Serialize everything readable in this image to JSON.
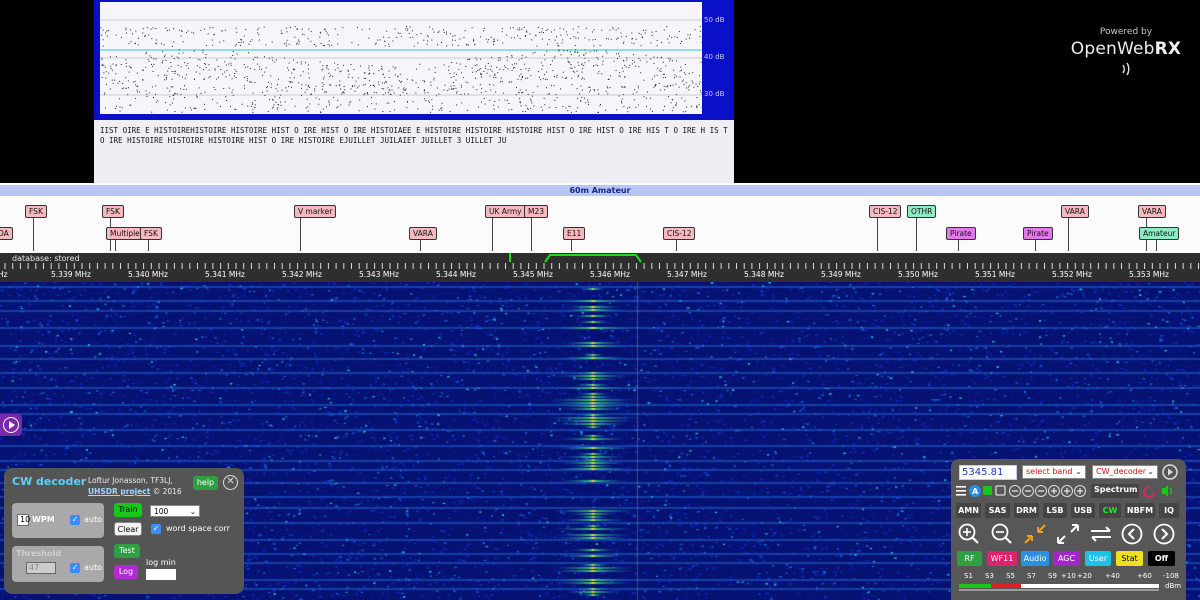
{
  "scope": {
    "db_labels": [
      "50 dB",
      "40 dB",
      "30 dB"
    ]
  },
  "decoded_text": "IIST OIRE E HISTOIREHISTOIRE HISTOIRE HIST O IRE HIST O IRE HISTOIAEE E HISTOIRE HISTOIRE HISTOIRE HIST O IRE HIST O IRE HIS T O IRE H IS T O IRE HISTOIRE HISTOIRE HISTOIRE HIST O IRE HISTOIRE EJUILLET JUILAIET JUILLET 3 UILLET JU",
  "powered": {
    "line1": "Powered by",
    "brand_plain": "OpenWeb",
    "brand_bold": "RX"
  },
  "band_name": "60m Amateur",
  "bookmarks": {
    "row1": [
      "FSK",
      "FSK",
      "V marker",
      "UK Army C",
      "M23",
      "CIS-12",
      "OTHR",
      "VARA",
      "VARA"
    ],
    "row2": [
      "DA",
      "Multiple F",
      "FSK",
      "VARA",
      "E11",
      "CIS-12",
      "Pirate",
      "Pirate",
      "Amateur"
    ]
  },
  "db_status": "database: stored",
  "scale_labels": [
    "5.339 MHz",
    "5.340 MHz",
    "5.341 MHz",
    "5.342 MHz",
    "5.343 MHz",
    "5.344 MHz",
    "5.345 MHz",
    "5.346 MHz",
    "5.347 MHz",
    "5.348 MHz",
    "5.349 MHz",
    "5.350 MHz",
    "5.351 MHz",
    "5.352 MHz",
    "5.353 MHz"
  ],
  "scale_left_fragment": "Hz",
  "cw": {
    "title": "CW decoder",
    "author": "Loftur Jonasson, TF3LJ,",
    "project_link": "UHSDR project",
    "year": "© 2016",
    "help": "help",
    "close_icon": "close-icon",
    "wpm_value": "10",
    "wpm_label": "WPM",
    "auto1": "auto",
    "train": "Train",
    "train_value": "100",
    "clear": "Clear",
    "word_space": "word space corr",
    "threshold_label": "Threshold",
    "threshold_value": "47",
    "auto2": "auto",
    "test": "Test",
    "log": "Log",
    "log_min": "log min"
  },
  "controls": {
    "frequency": "5345.81",
    "band_select": "select band",
    "mode_select": "CW_decoder",
    "spectrum": "Spectrum",
    "modes": [
      "AMN",
      "SAS",
      "DRM",
      "LSB",
      "USB",
      "CW",
      "NBFM",
      "IQ"
    ],
    "active_mode": "CW",
    "tools": [
      "RF",
      "WF11",
      "Audio",
      "AGC",
      "User",
      "Stat",
      "Off"
    ],
    "smeter_labels": [
      "S1",
      "S3",
      "S5",
      "S7",
      "S9",
      "+10",
      "+20",
      "+40",
      "+60",
      "-108",
      "dBm"
    ],
    "colors": {
      "RF": "#2ea043",
      "WF11": "#e0226e",
      "Audio": "#2b8fe6",
      "AGC": "#a326c8",
      "User": "#18c4e8",
      "Stat": "#f0e020",
      "Off": "#000000"
    }
  }
}
